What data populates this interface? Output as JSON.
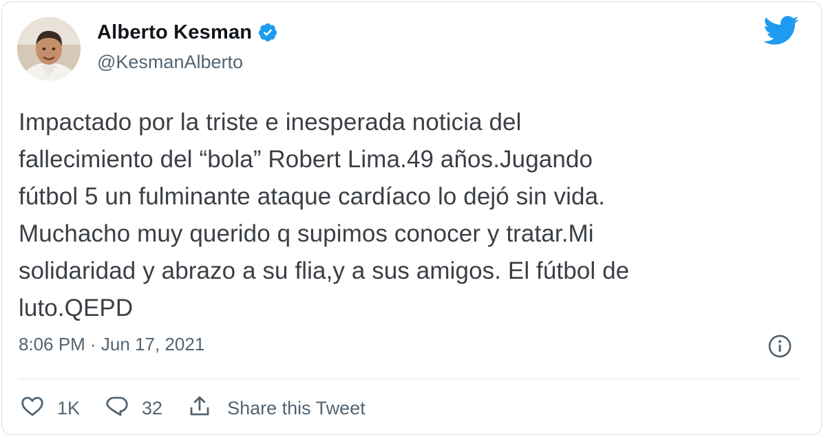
{
  "author": {
    "name": "Alberto Kesman",
    "handle": "@KesmanAlberto",
    "verified": true
  },
  "tweet": {
    "text": "Impactado por la triste e inesperada noticia del\nfallecimiento del “bola” Robert Lima.49 años.Jugando\nfútbol 5 un fulminante ataque cardíaco lo dejó sin vida.\nMuchacho muy querido q supimos conocer y tratar.Mi\nsolidaridad y abrazo a su flia,y a sus amigos. El fútbol de\nluto.QEPD",
    "timestamp": "8:06 PM · Jun 17, 2021"
  },
  "actions": {
    "likes": "1K",
    "replies": "32",
    "share_label": "Share this Tweet"
  },
  "icons": {
    "brand": "twitter-bird-icon",
    "verified": "verified-badge-icon",
    "info": "info-icon",
    "like": "heart-icon",
    "reply": "reply-icon",
    "share": "share-icon"
  },
  "colors": {
    "brand_blue": "#1d9bf0",
    "secondary_text": "#536471",
    "primary_text": "#0f1419"
  }
}
